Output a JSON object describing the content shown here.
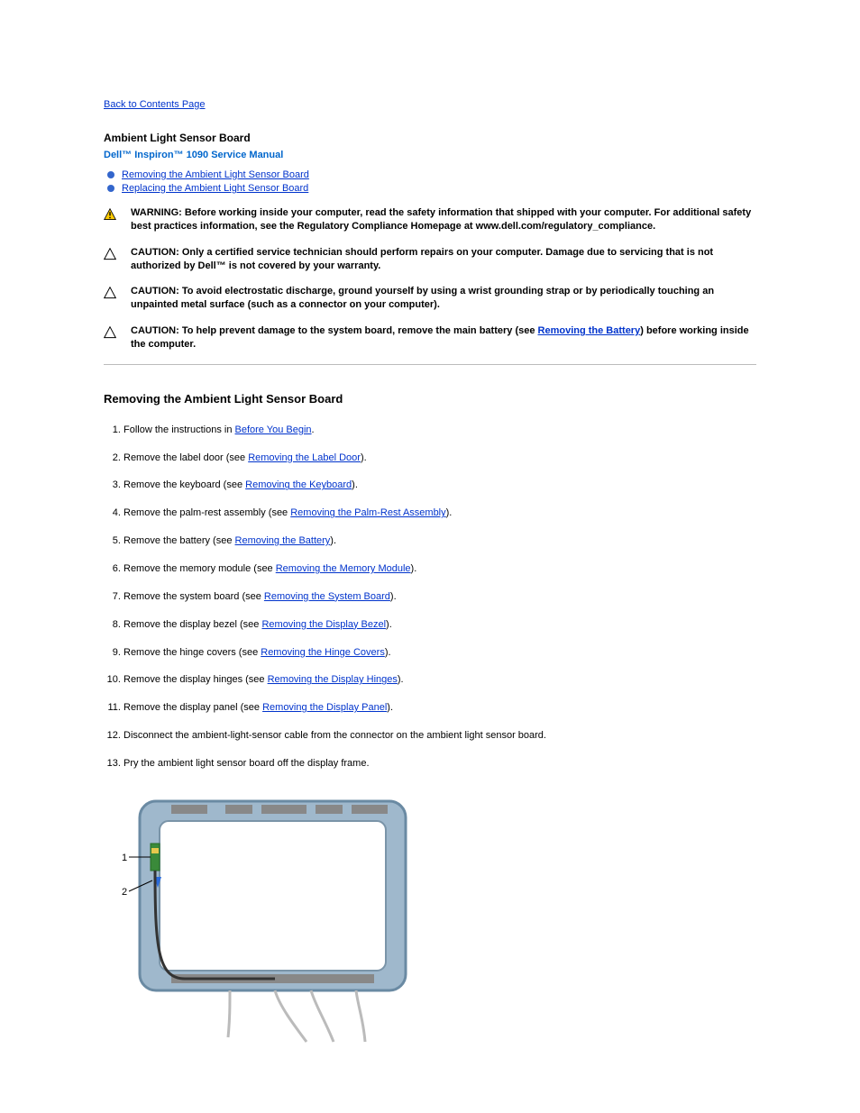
{
  "nav": {
    "back_label": "Back to Contents Page"
  },
  "header": {
    "title": "Ambient Light Sensor Board",
    "subtitle": "Dell™ Inspiron™ 1090 Service Manual"
  },
  "toc": {
    "item1": "Removing the Ambient Light Sensor Board",
    "item2": "Replacing the Ambient Light Sensor Board"
  },
  "warning": {
    "lead": "WARNING: ",
    "text": "Before working inside your computer, read the safety information that shipped with your computer. For additional safety best practices information, see the Regulatory Compliance Homepage at www.dell.com/regulatory_compliance."
  },
  "caution1": {
    "lead": "CAUTION: ",
    "text": "Only a certified service technician should perform repairs on your computer. Damage due to servicing that is not authorized by Dell™ is not covered by your warranty."
  },
  "caution2": {
    "lead": "CAUTION: ",
    "text": "To avoid electrostatic discharge, ground yourself by using a wrist grounding strap or by periodically touching an unpainted metal surface (such as a connector on your computer)."
  },
  "caution3": {
    "lead": "CAUTION: ",
    "prefix": "To help prevent damage to the system board, remove the main battery (see ",
    "link": "Removing the Battery",
    "suffix": ") before working inside the computer."
  },
  "section": {
    "title": "Removing the Ambient Light Sensor Board"
  },
  "steps": [
    {
      "pre": "Follow the instructions in ",
      "link": "Before You Begin",
      "post": "."
    },
    {
      "pre": "Remove the label door (see ",
      "link": "Removing the Label Door",
      "post": ")."
    },
    {
      "pre": "Remove the keyboard (see ",
      "link": "Removing the Keyboard",
      "post": ")."
    },
    {
      "pre": "Remove the palm-rest assembly (see ",
      "link": "Removing the Palm-Rest Assembly",
      "post": ")."
    },
    {
      "pre": "Remove the battery (see ",
      "link": "Removing the Battery",
      "post": ")."
    },
    {
      "pre": "Remove the memory module (see ",
      "link": "Removing the Memory Module",
      "post": ")."
    },
    {
      "pre": "Remove the system board (see ",
      "link": "Removing the System Board",
      "post": ")."
    },
    {
      "pre": "Remove the display bezel (see ",
      "link": "Removing the Display Bezel",
      "post": ")."
    },
    {
      "pre": "Remove the hinge covers (see ",
      "link": "Removing the Hinge Covers",
      "post": ")."
    },
    {
      "pre": "Remove the display hinges (see ",
      "link": "Removing the Display Hinges",
      "post": ")."
    },
    {
      "pre": "Remove the display panel (see ",
      "link": "Removing the Display Panel",
      "post": ")."
    },
    {
      "pre": "Disconnect the ambient-light-sensor cable from the connector on the ambient light sensor board.",
      "link": "",
      "post": ""
    },
    {
      "pre": "Pry the ambient light sensor board off the display frame.",
      "link": "",
      "post": ""
    }
  ],
  "callouts": {
    "c1": "1",
    "c2": "2"
  }
}
